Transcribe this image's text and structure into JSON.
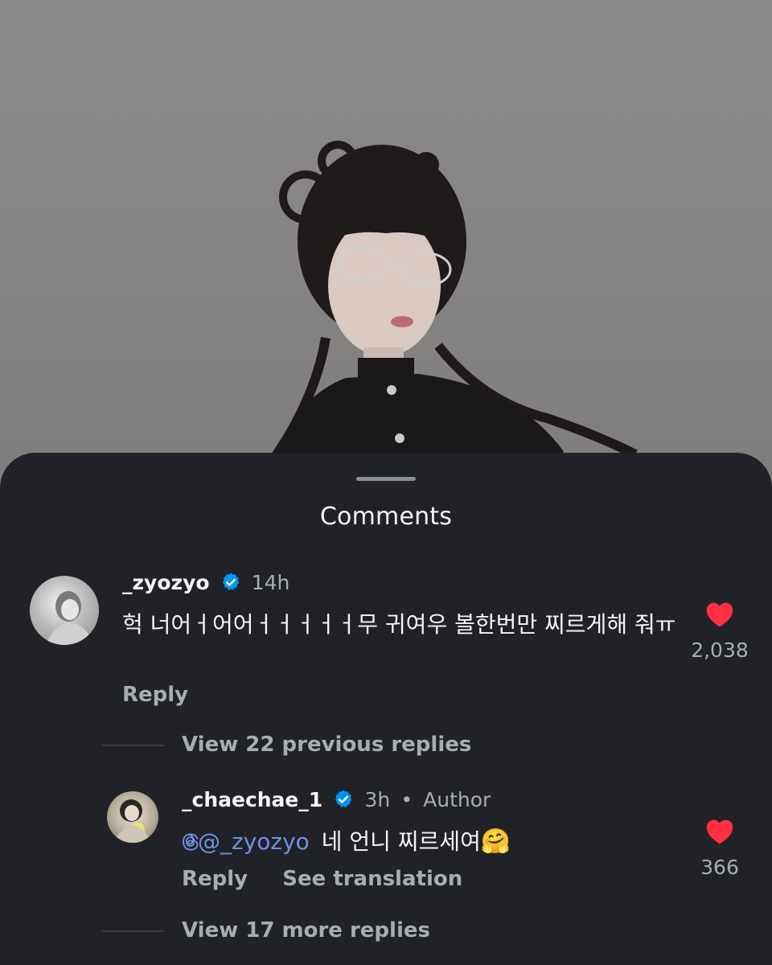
{
  "sheet": {
    "title": "Comments"
  },
  "comments": [
    {
      "username": "_zyozyo",
      "time": "14h",
      "text": "헉 너어ㅓ어어ㅓㅓㅓㅓㅓ무 귀여우 볼한번만 찌르게해 줘ㅠ",
      "reply_label": "Reply",
      "likes": "2,038",
      "view_replies": "View 22 previous replies"
    }
  ],
  "reply": {
    "username": "_chaechae_1",
    "time": "3h",
    "separator": "•",
    "badge": "Author",
    "mention": "@_zyozyo",
    "text": "네 언니 찌르세여",
    "emoji": "🤗",
    "reply_label": "Reply",
    "translate_label": "See translation",
    "likes": "366",
    "view_more": "View 17 more replies"
  },
  "colors": {
    "sheet_bg": "#212227",
    "like_red": "#ff3040",
    "verified_blue": "#0095f6",
    "mention_blue": "#6f8fe8",
    "muted": "#a8adb3"
  },
  "icons": [
    "verified-badge-icon",
    "heart-icon",
    "threads-icon"
  ]
}
